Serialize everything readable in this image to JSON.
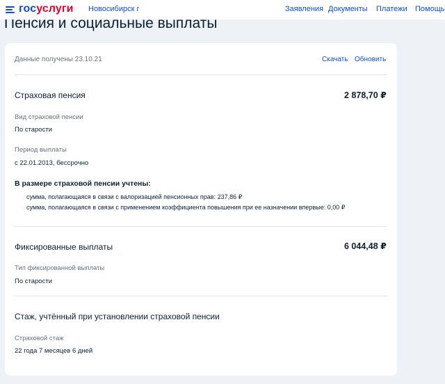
{
  "header": {
    "logo": {
      "part1": "гос",
      "part2": "услуги"
    },
    "region": "Новосибирск г",
    "nav": [
      "Заявления",
      "Документы",
      "Платежи",
      "Помощь"
    ]
  },
  "page_title": "Пенсия и социальные выплаты",
  "card": {
    "data_received": "Данные получены 23.10.21",
    "download": "Скачать",
    "refresh": "Обновить",
    "insurance_pension": {
      "title": "Страховая пенсия",
      "amount": "2 878,70 ₽",
      "type_label": "Вид страховой пенсии",
      "type_value": "По старости",
      "period_label": "Период выплаты",
      "period_value": "с 22.01.2013, бессрочно",
      "included_heading": "В размере страховой пенсии учтены:",
      "included_items": [
        "сумма, полагающаяся в связи с валоризацией пенсионных прав: 237,86 ₽",
        "сумма, полагающаяся в связи с применением коэффициента повышения при ее назначении впервые: 0,00 ₽"
      ]
    },
    "fixed_payments": {
      "title": "Фиксированные выплаты",
      "amount": "6 044,48 ₽",
      "type_label": "Тип фиксированной выплаты",
      "type_value": "По старости"
    },
    "experience": {
      "title": "Стаж, учтённый при установлении страховой пенсии",
      "label": "Страховой стаж",
      "value": "22 года 7 месяцев 6 дней"
    }
  },
  "colors": {
    "brand_blue": "#0d4cd3",
    "brand_red": "#e4002b",
    "text": "#0b1f33",
    "muted": "#66727f",
    "background": "#eef1f6"
  }
}
